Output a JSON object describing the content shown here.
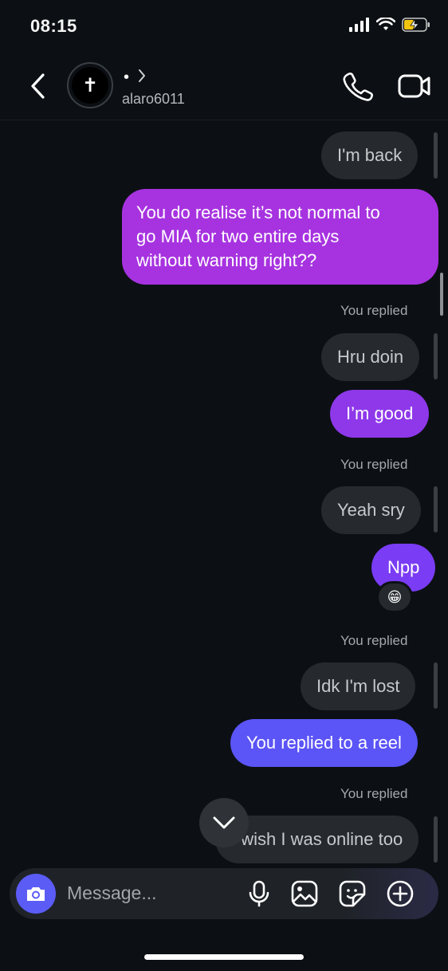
{
  "status_bar": {
    "time": "08:15"
  },
  "header": {
    "display_name": "•",
    "username": "alaro6011",
    "avatar_glyph": "✝"
  },
  "messages": [
    {
      "type": "received",
      "text": "I'm back"
    },
    {
      "type": "sent",
      "lines": [
        "You do realise it’s not normal to",
        "go MIA for two entire days",
        "without warning right??"
      ]
    },
    {
      "type": "replied_label",
      "text": "You replied"
    },
    {
      "type": "received",
      "text": "Hru doin"
    },
    {
      "type": "sent",
      "text": "I’m good"
    },
    {
      "type": "replied_label",
      "text": "You replied"
    },
    {
      "type": "received",
      "text": "Yeah sry"
    },
    {
      "type": "sent",
      "text": "Npp",
      "reaction": "😁"
    },
    {
      "type": "replied_label",
      "text": "You replied"
    },
    {
      "type": "received",
      "text": "Idk I'm lost"
    },
    {
      "type": "sent",
      "text": "You replied to a reel"
    },
    {
      "type": "replied_label",
      "text": "You replied"
    },
    {
      "type": "received",
      "text": "I wish I was online too"
    }
  ],
  "composer": {
    "placeholder": "Message..."
  },
  "colors": {
    "sent_purple": "#a733e0",
    "sent_violet": "#7a3cf4",
    "sent_blue": "#5b54f6",
    "received": "#262a2f",
    "camera": "#5b5cf6"
  },
  "icons": [
    "back-icon",
    "call-icon",
    "video-icon",
    "camera-icon",
    "microphone-icon",
    "gallery-icon",
    "sticker-icon",
    "plus-icon",
    "chevron-down-icon"
  ]
}
